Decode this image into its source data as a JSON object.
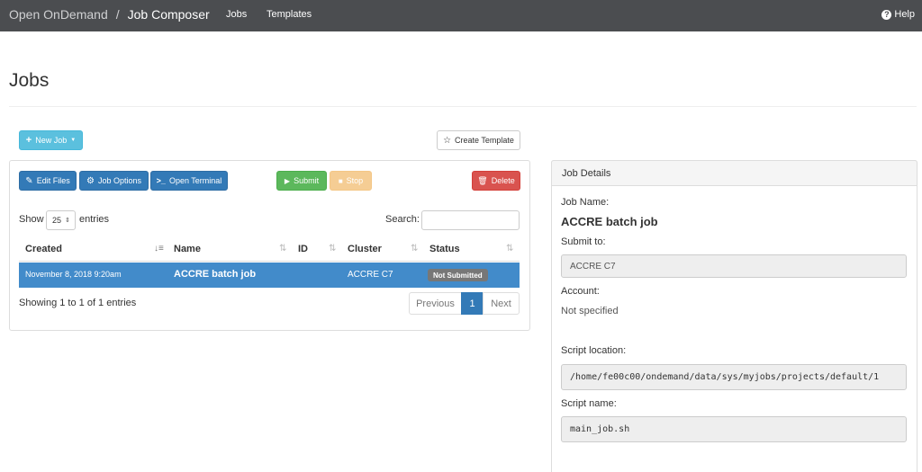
{
  "navbar": {
    "brand": "Open OnDemand",
    "separator": "/",
    "app_name": "Job Composer",
    "links": [
      "Jobs",
      "Templates"
    ],
    "help": "Help"
  },
  "page": {
    "title": "Jobs"
  },
  "toolbar": {
    "new_job": "New Job",
    "create_template": "Create Template",
    "edit_files": "Edit Files",
    "job_options": "Job Options",
    "open_terminal": "Open Terminal",
    "submit": "Submit",
    "stop": "Stop",
    "delete": "Delete"
  },
  "table_controls": {
    "show_label": "Show",
    "page_length": "25",
    "entries_label": "entries",
    "search_label": "Search:",
    "search_value": ""
  },
  "table": {
    "columns": [
      "Created",
      "Name",
      "ID",
      "Cluster",
      "Status"
    ],
    "rows": [
      {
        "created": "November 8, 2018 9:20am",
        "name": "ACCRE batch job",
        "id": "",
        "cluster": "ACCRE C7",
        "status": "Not Submitted"
      }
    ],
    "info": "Showing 1 to 1 of 1 entries",
    "pagination": {
      "previous": "Previous",
      "current": "1",
      "next": "Next"
    }
  },
  "details": {
    "heading": "Job Details",
    "job_name_label": "Job Name:",
    "job_name": "ACCRE batch job",
    "submit_to_label": "Submit to:",
    "submit_to": "ACCRE C7",
    "account_label": "Account:",
    "account": "Not specified",
    "script_location_label": "Script location:",
    "script_location": "/home/fe00c00/ondemand/data/sys/myjobs/projects/default/1",
    "script_name_label": "Script name:",
    "script_name": "main_job.sh"
  },
  "colors": {
    "navbar": "#4b4d50",
    "primary": "#337ab7",
    "selected_row": "#428bca",
    "info": "#5bc0de",
    "success": "#5cb85c",
    "warning": "#f0ad4e",
    "danger": "#d9534f"
  }
}
